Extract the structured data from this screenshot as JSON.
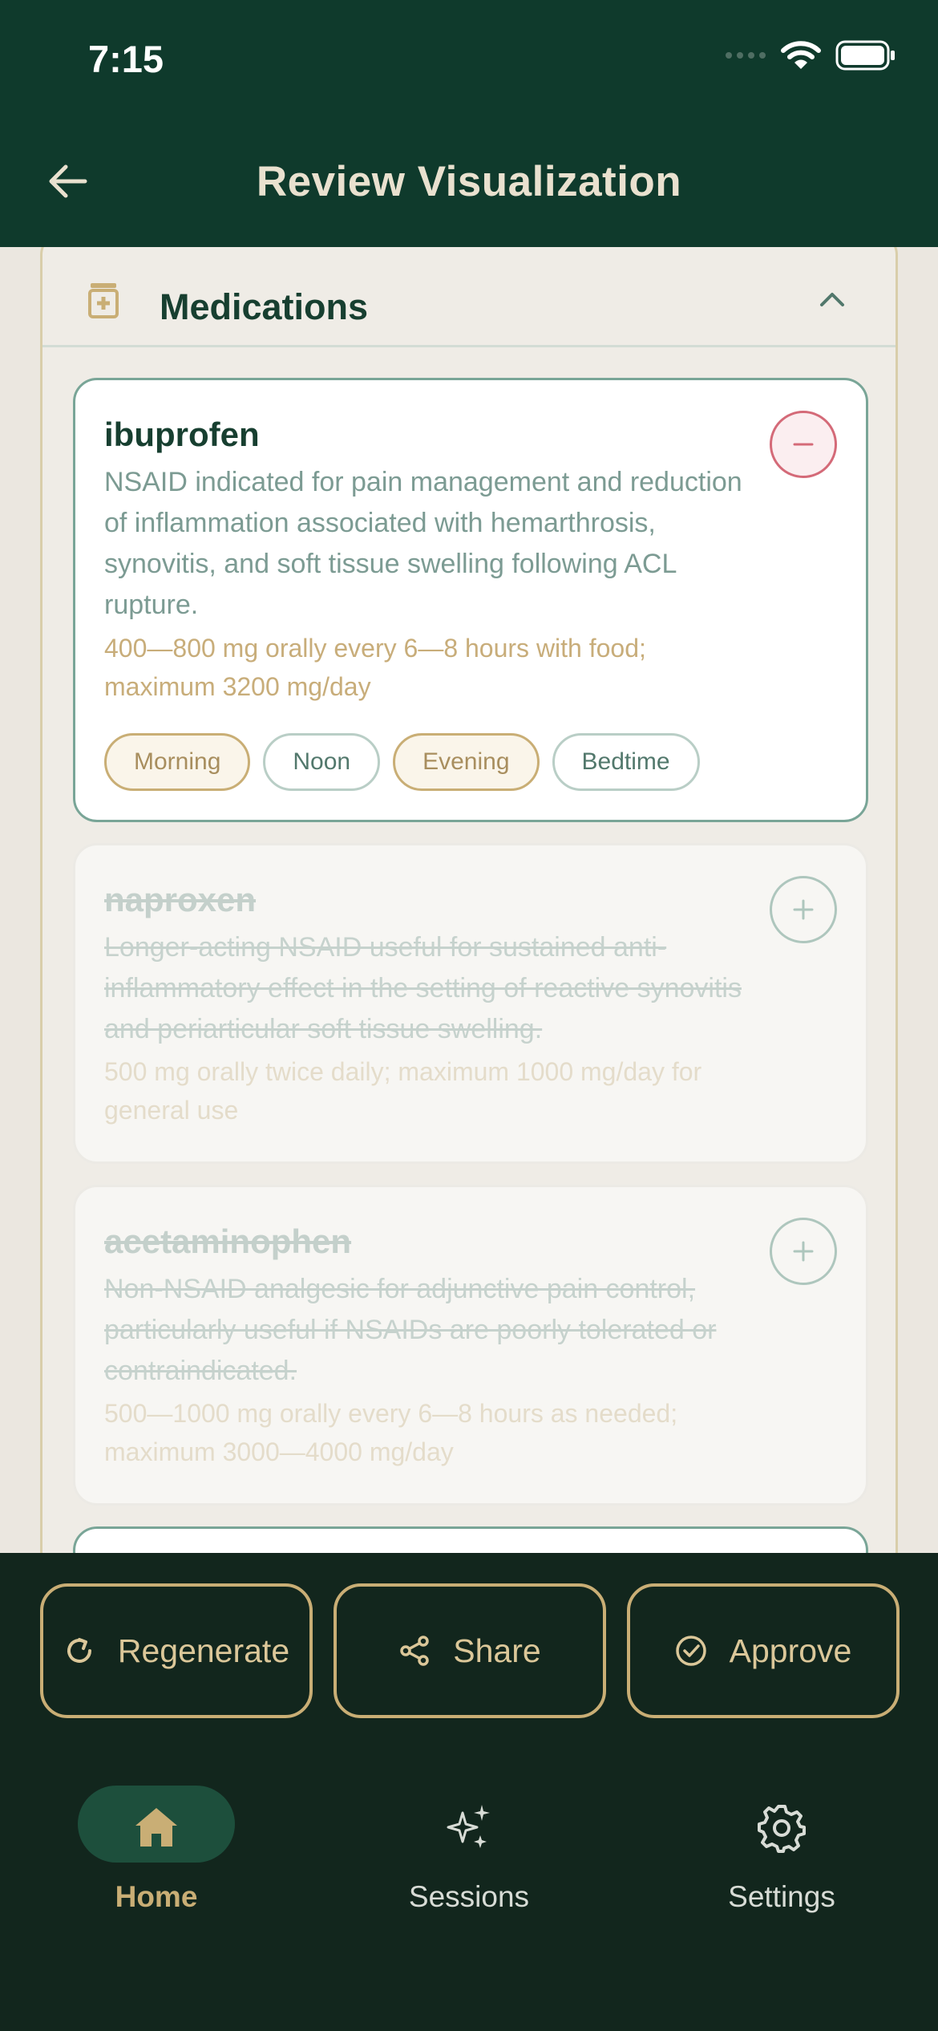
{
  "status_bar": {
    "time": "7:15"
  },
  "header": {
    "title": "Review Visualization"
  },
  "section": {
    "title": "Medications"
  },
  "medications": [
    {
      "name": "ibuprofen",
      "description": "NSAID indicated for pain management and reduction of inflammation associated with hemarthrosis, synovitis, and soft tissue swelling following ACL rupture.",
      "dose": "400—800 mg orally every 6—8 hours with food; maximum 3200 mg/day",
      "times": [
        {
          "label": "Morning",
          "selected": true
        },
        {
          "label": "Noon",
          "selected": false
        },
        {
          "label": "Evening",
          "selected": true
        },
        {
          "label": "Bedtime",
          "selected": false
        }
      ],
      "included": true
    },
    {
      "name": "naproxen",
      "description": "Longer-acting NSAID useful for sustained anti-inflammatory effect in the setting of reactive synovitis and periarticular soft tissue swelling.",
      "dose": "500 mg orally twice daily; maximum 1000 mg/day for general use",
      "included": false
    },
    {
      "name": "acetaminophen",
      "description": "Non-NSAID analgesic for adjunctive pain control, particularly useful if NSAIDs are poorly tolerated or contraindicated.",
      "dose": "500—1000 mg orally every 6—8 hours as needed; maximum 3000—4000 mg/day",
      "included": false
    }
  ],
  "actions": {
    "regenerate": "Regenerate",
    "share": "Share",
    "approve": "Approve"
  },
  "nav": {
    "home": "Home",
    "sessions": "Sessions",
    "settings": "Settings",
    "active": "Home"
  },
  "colors": {
    "header_bg": "#0f3a2c",
    "bottom_bg": "#12261d",
    "accent_gold": "#c9ae75",
    "remove_red": "#d46a78"
  }
}
